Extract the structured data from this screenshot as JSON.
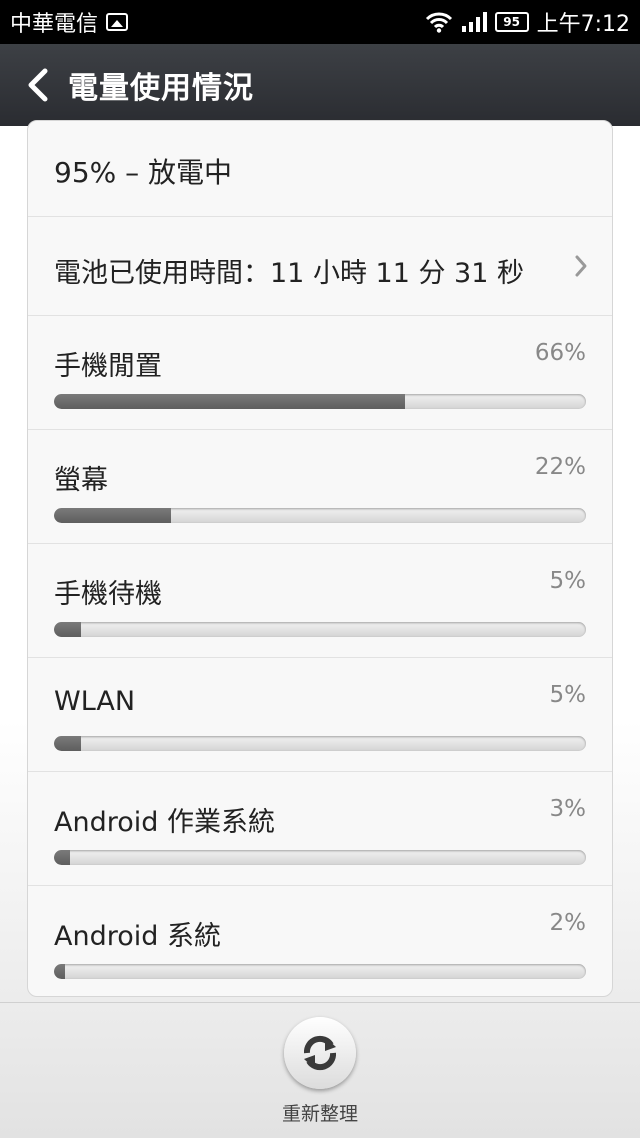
{
  "statusbar": {
    "carrier": "中華電信",
    "battery_level": "95",
    "time": "上午7:12"
  },
  "header": {
    "title": "電量使用情況"
  },
  "summary": {
    "status": "95% – 放電中",
    "usage_time": "電池已使用時間：11 小時 11 分 31 秒"
  },
  "usage_items": [
    {
      "name": "手機閒置",
      "percent_label": "66%",
      "percent": 66
    },
    {
      "name": "螢幕",
      "percent_label": "22%",
      "percent": 22
    },
    {
      "name": "手機待機",
      "percent_label": "5%",
      "percent": 5
    },
    {
      "name": "WLAN",
      "percent_label": "5%",
      "percent": 5
    },
    {
      "name": "Android 作業系統",
      "percent_label": "3%",
      "percent": 3
    },
    {
      "name": "Android 系統",
      "percent_label": "2%",
      "percent": 2
    }
  ],
  "bottom": {
    "refresh_label": "重新整理"
  }
}
